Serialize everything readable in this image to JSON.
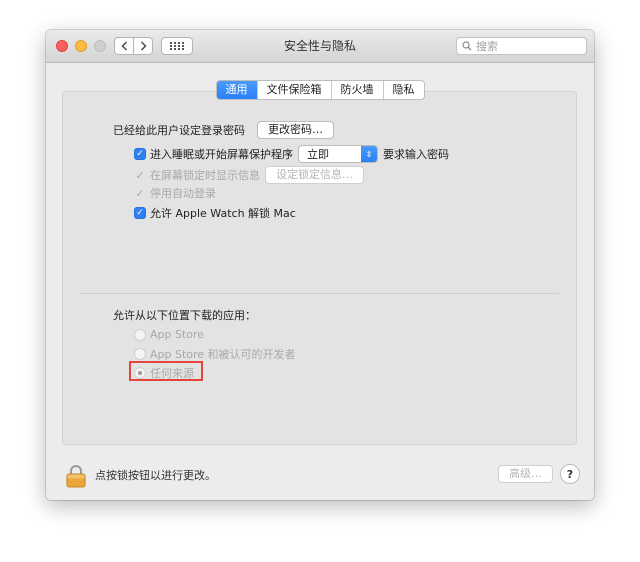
{
  "window": {
    "title": "安全性与隐私",
    "search_placeholder": "搜索"
  },
  "tabs": [
    {
      "label": "通用",
      "active": true
    },
    {
      "label": "文件保险箱",
      "active": false
    },
    {
      "label": "防火墙",
      "active": false
    },
    {
      "label": "隐私",
      "active": false
    }
  ],
  "general": {
    "password_label": "已经给此用户设定登录密码",
    "change_password_button": "更改密码…",
    "sleep_checkbox_label": "进入睡眠或开始屏幕保护程序",
    "sleep_delay_value": "立即",
    "require_password_label": "要求输入密码",
    "lock_message_label": "在屏幕锁定时显示信息",
    "set_lock_message_button": "设定锁定信息…",
    "disable_autologin_label": "停用自动登录",
    "apple_watch_label": "允许 Apple Watch 解锁 Mac"
  },
  "downloads": {
    "heading": "允许从以下位置下载的应用：",
    "options": [
      {
        "label": "App Store",
        "selected": false
      },
      {
        "label": "App Store 和被认可的开发者",
        "selected": false
      },
      {
        "label": "任何来源",
        "selected": true
      }
    ]
  },
  "footer": {
    "lock_text": "点按锁按钮以进行更改。",
    "advanced_button": "高级…",
    "help_button": "?"
  },
  "colors": {
    "accent": "#2f80f5",
    "highlight_box": "#e2463a"
  }
}
